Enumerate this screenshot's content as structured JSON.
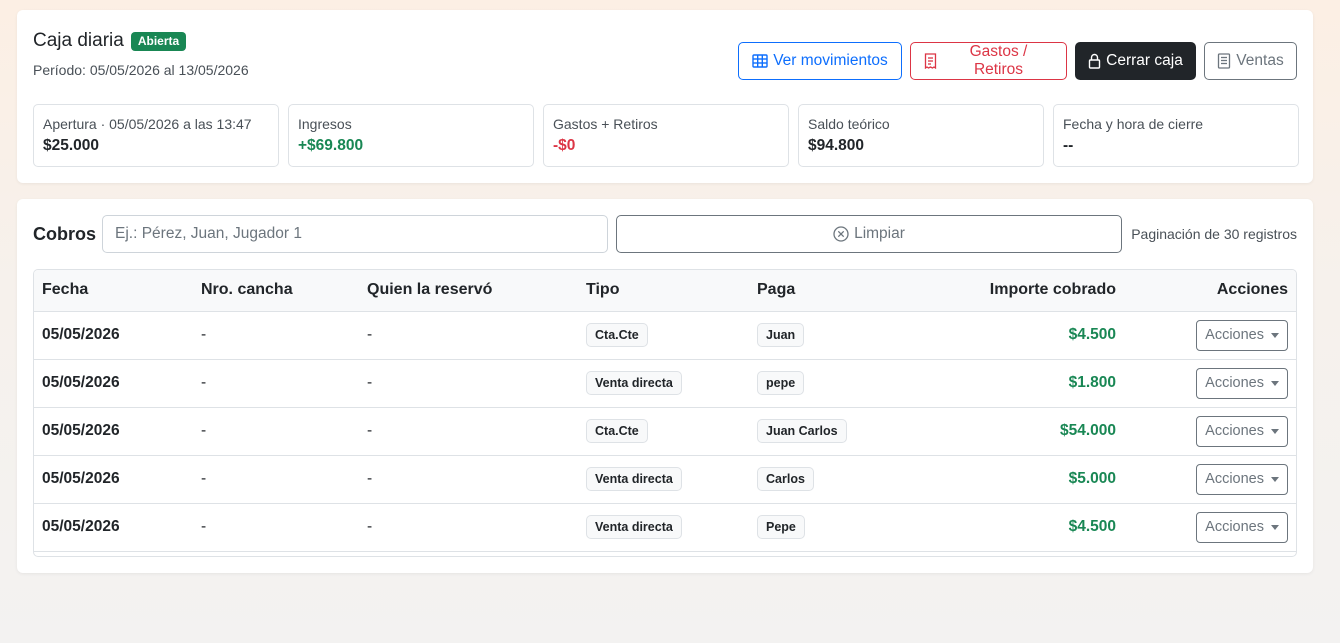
{
  "header": {
    "title": "Caja diaria",
    "status_badge": "Abierta",
    "period": "Período: 05/05/2026 al 13/05/2026"
  },
  "toolbar": {
    "ver_movimientos": "Ver movimientos",
    "gastos_retiros": "Gastos / Retiros",
    "cerrar_caja": "Cerrar caja",
    "ventas": "Ventas"
  },
  "stats": [
    {
      "label": "Apertura · 05/05/2026 a las 13:47",
      "value": "$25.000"
    },
    {
      "label": "Ingresos",
      "value": "+$69.800"
    },
    {
      "label": "Gastos + Retiros",
      "value": "-$0"
    },
    {
      "label": "Saldo teórico",
      "value": "$94.800"
    },
    {
      "label": "Fecha y hora de cierre",
      "value": "--"
    }
  ],
  "cobros": {
    "title": "Cobros",
    "search_placeholder": "Ej.: Pérez, Juan, Jugador 1",
    "clear_label": "Limpiar",
    "pagination_note": "Paginación de 30 registros",
    "columns": [
      "Fecha",
      "Nro. cancha",
      "Quien la reservó",
      "Tipo",
      "Paga",
      "Importe cobrado",
      "Acciones"
    ],
    "actions_label": "Acciones",
    "rows": [
      {
        "fecha": "05/05/2026",
        "cancha": "-",
        "quien": "-",
        "tipo": "Cta.Cte",
        "paga": "Juan",
        "importe": "$4.500"
      },
      {
        "fecha": "05/05/2026",
        "cancha": "-",
        "quien": "-",
        "tipo": "Venta directa",
        "paga": "pepe",
        "importe": "$1.800"
      },
      {
        "fecha": "05/05/2026",
        "cancha": "-",
        "quien": "-",
        "tipo": "Cta.Cte",
        "paga": "Juan Carlos",
        "importe": "$54.000"
      },
      {
        "fecha": "05/05/2026",
        "cancha": "-",
        "quien": "-",
        "tipo": "Venta directa",
        "paga": "Carlos",
        "importe": "$5.000"
      },
      {
        "fecha": "05/05/2026",
        "cancha": "-",
        "quien": "-",
        "tipo": "Venta directa",
        "paga": "Pepe",
        "importe": "$4.500"
      }
    ]
  },
  "colors": {
    "success": "#198754",
    "danger": "#dc3545",
    "primary": "#0d6efd",
    "dark": "#212529",
    "secondary": "#6c757d"
  }
}
